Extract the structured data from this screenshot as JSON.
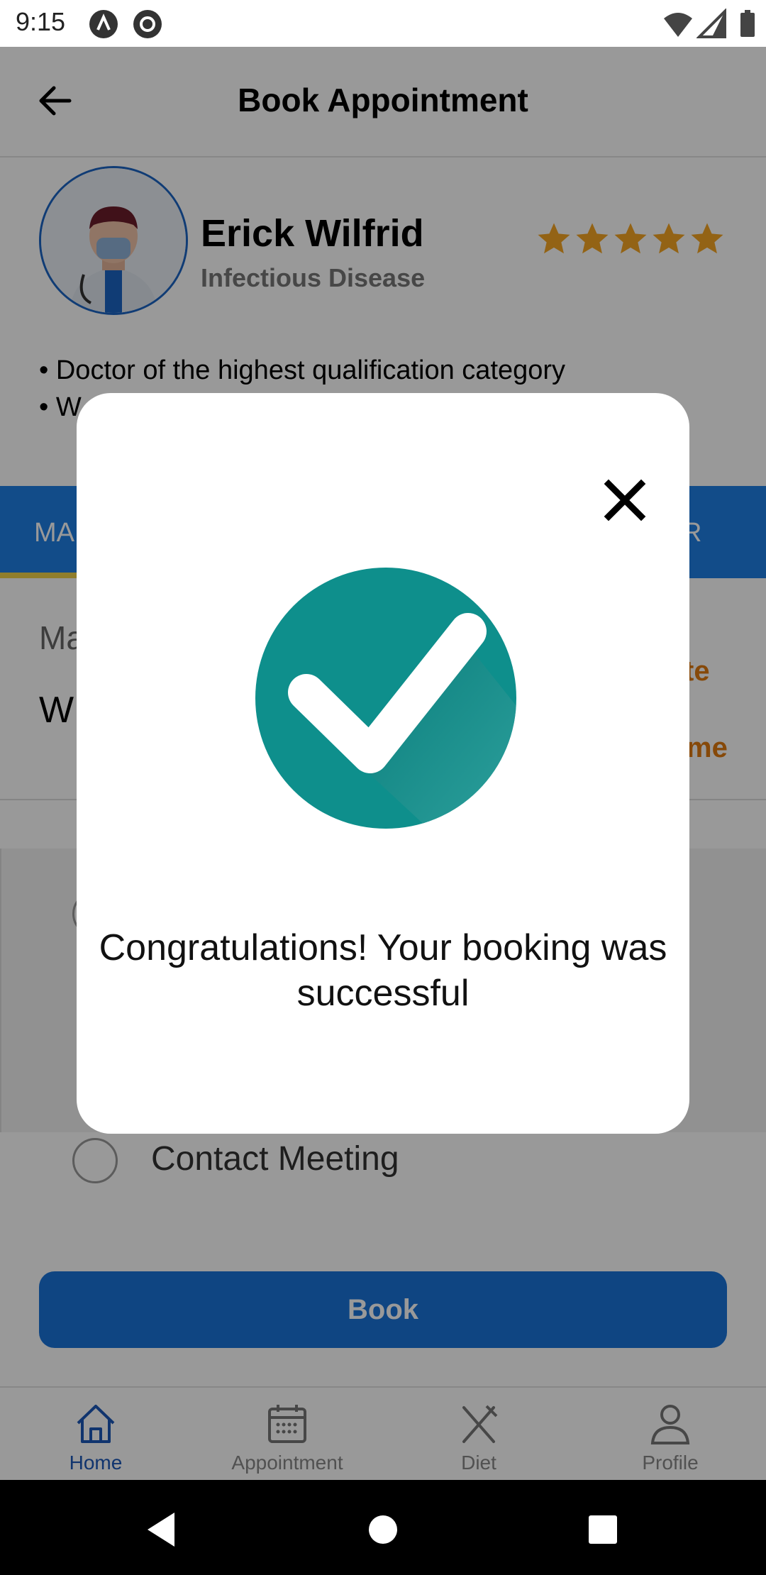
{
  "status_bar": {
    "time": "9:15"
  },
  "header": {
    "title": "Book Appointment"
  },
  "doctor": {
    "name": "Erick Wilfrid",
    "specialty": "Infectious Disease",
    "rating_stars": 5,
    "bullets": [
      "• Doctor of the highest qualification category",
      "• W"
    ]
  },
  "tabs": {
    "left_label": "MA",
    "right_label": "R"
  },
  "background_content": {
    "section_label": "Ma",
    "section_value": "W",
    "orange_1": "te",
    "orange_2": "me",
    "contact_option": "Contact Meeting"
  },
  "book_button": {
    "label": "Book"
  },
  "bottom_nav": {
    "items": [
      {
        "label": "Home",
        "icon": "home-icon",
        "active": true
      },
      {
        "label": "Appointment",
        "icon": "calendar-icon",
        "active": false
      },
      {
        "label": "Diet",
        "icon": "utensils-icon",
        "active": false
      },
      {
        "label": "Profile",
        "icon": "person-icon",
        "active": false
      }
    ]
  },
  "dialog": {
    "message": "Congratulations! Your booking was successful",
    "icon": "check-icon",
    "accent": "#0e8f8c"
  },
  "colors": {
    "primary": "#1f7fe5",
    "accent_orange": "#e07a10",
    "star": "#f5a623"
  }
}
